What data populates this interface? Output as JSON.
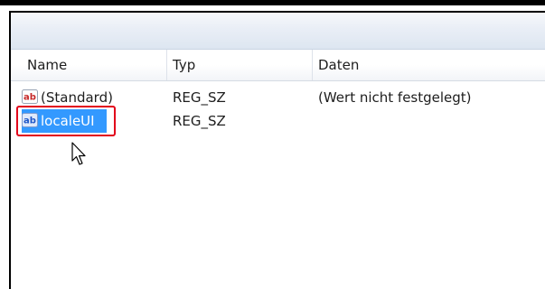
{
  "list": {
    "columns": {
      "name": "Name",
      "type": "Typ",
      "data": "Daten"
    },
    "rows": [
      {
        "name": "(Standard)",
        "type": "REG_SZ",
        "data": "(Wert nicht festgelegt)",
        "icon": "string-value-icon"
      },
      {
        "name": "localeUI",
        "type": "REG_SZ",
        "data": "",
        "icon": "string-value-icon",
        "selected": true
      }
    ]
  },
  "icon_label": "ab",
  "colors": {
    "selection": "#3399ff",
    "highlight_box": "#e2001a",
    "icon_red": "#c62828",
    "icon_blue": "#1f57c8"
  }
}
